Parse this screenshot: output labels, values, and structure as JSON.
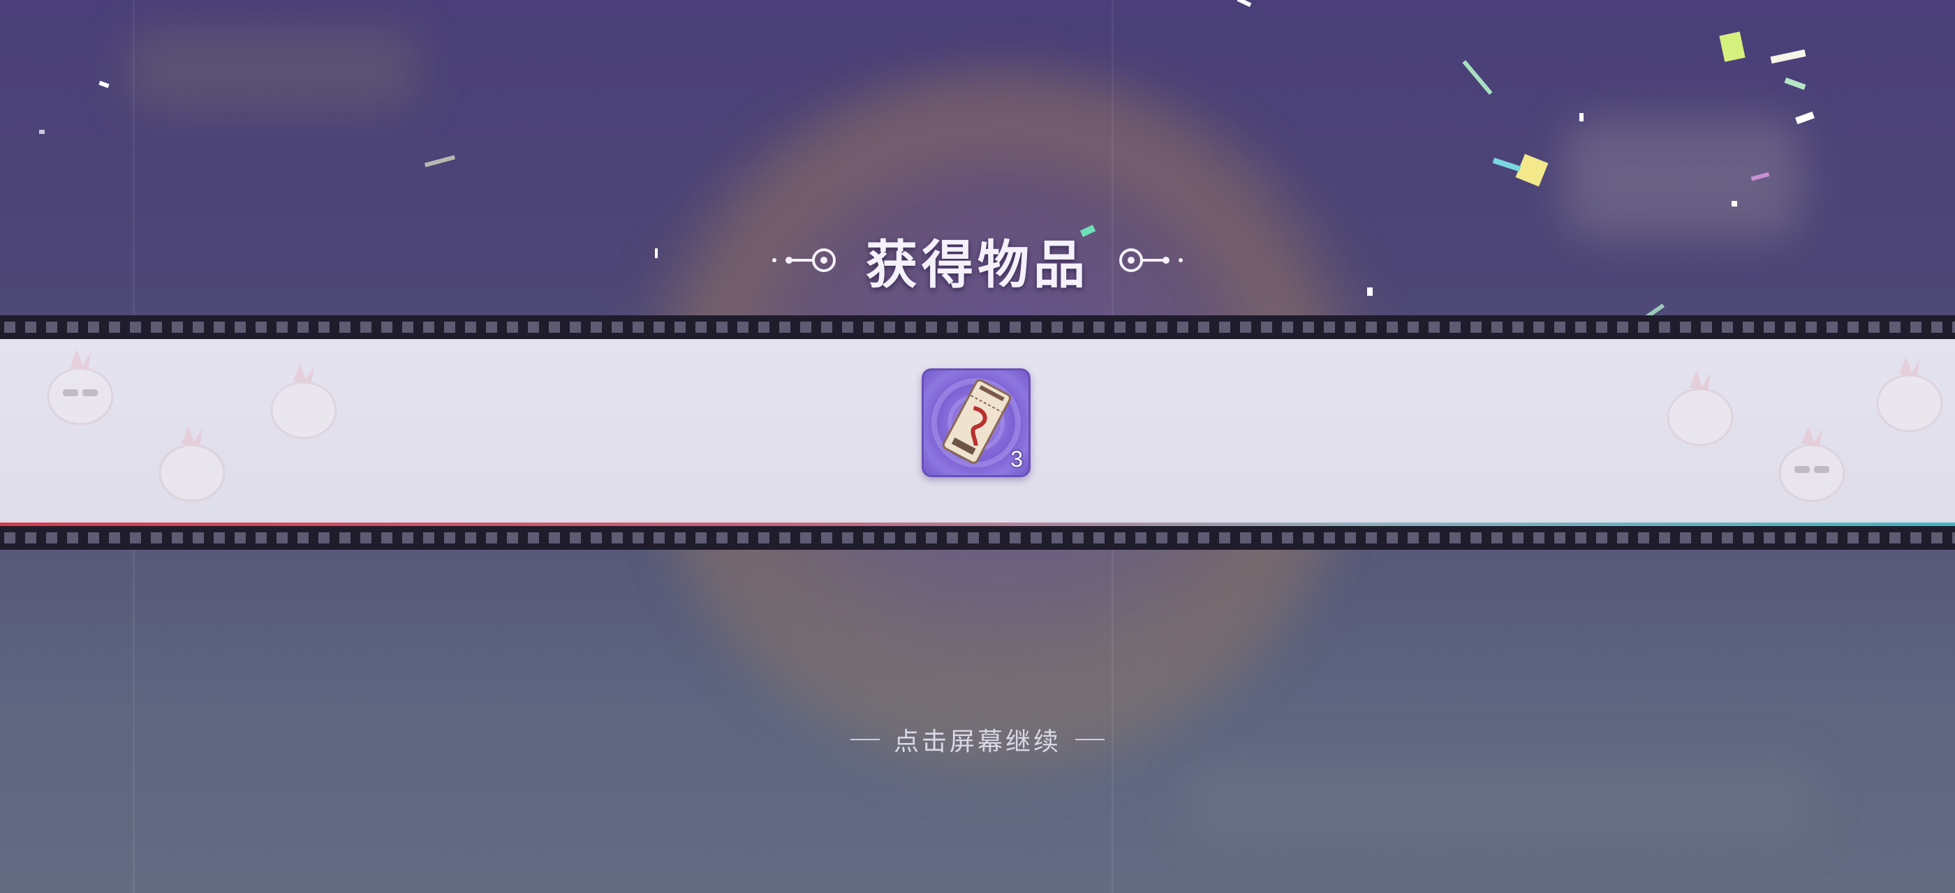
{
  "reward_popup": {
    "title": "获得物品",
    "items": [
      {
        "icon": "ticket-icon",
        "count": "3"
      }
    ],
    "continue_hint": "点击屏幕继续"
  },
  "colors": {
    "banner": "#e4e3ef",
    "item_frame": "#7b5fd2",
    "film_strip": "#1f1c2b",
    "accent_left": "#d83a4a",
    "accent_right": "#3fb6bf"
  }
}
